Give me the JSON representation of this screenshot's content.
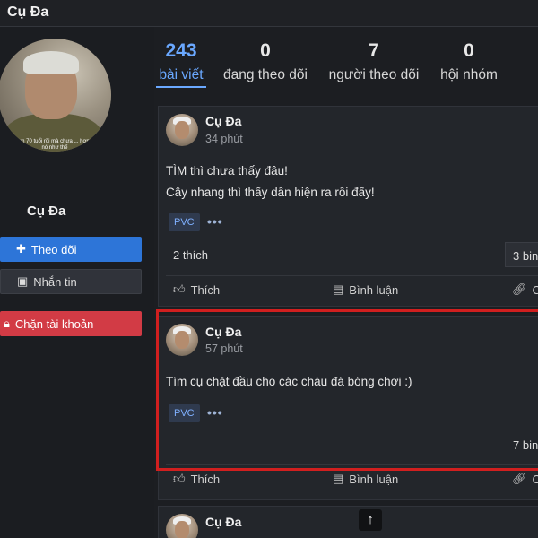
{
  "header": {
    "title": "Cụ Đa"
  },
  "profile": {
    "name": "Cụ Đa",
    "avatar_caption": "...nay hơn 70 tuổi rồi mà chưa ... hợp nào mà nó như thế",
    "follow_label": "Theo dõi",
    "message_label": "Nhắn tin",
    "block_label": "Chặn tài khoản"
  },
  "stats": [
    {
      "value": "243",
      "label": "bài viết",
      "active": true
    },
    {
      "value": "0",
      "label": "đang theo dõi",
      "active": false
    },
    {
      "value": "7",
      "label": "người theo dõi",
      "active": false
    },
    {
      "value": "0",
      "label": "hội nhóm",
      "active": false
    }
  ],
  "posts": [
    {
      "author": "Cụ Đa",
      "time": "34 phút",
      "lines": [
        "TÌM thì chưa thấy đâu!",
        "Cây nhang thì thấy dần hiện ra rồi đấy!"
      ],
      "tag": "PVC",
      "more": "•••",
      "likes": "2 thích",
      "comments": "3 bin",
      "actions": {
        "like": "Thích",
        "comment": "Bình luận",
        "share": "C"
      }
    },
    {
      "author": "Cụ Đa",
      "time": "57 phút",
      "lines": [
        "Tím cụ chặt đầu cho các cháu đá bóng chơi :)"
      ],
      "tag": "PVC",
      "more": "•••",
      "comments": "7 bin",
      "actions": {
        "like": "Thích",
        "comment": "Bình luận",
        "share": "C"
      }
    },
    {
      "author": "Cụ Đa"
    }
  ],
  "scroll_top_icon": "arrow-up-icon",
  "colors": {
    "accent": "#2d75d8",
    "danger": "#d23b45",
    "highlight": "#d11f1f",
    "link": "#6aa8ff"
  }
}
